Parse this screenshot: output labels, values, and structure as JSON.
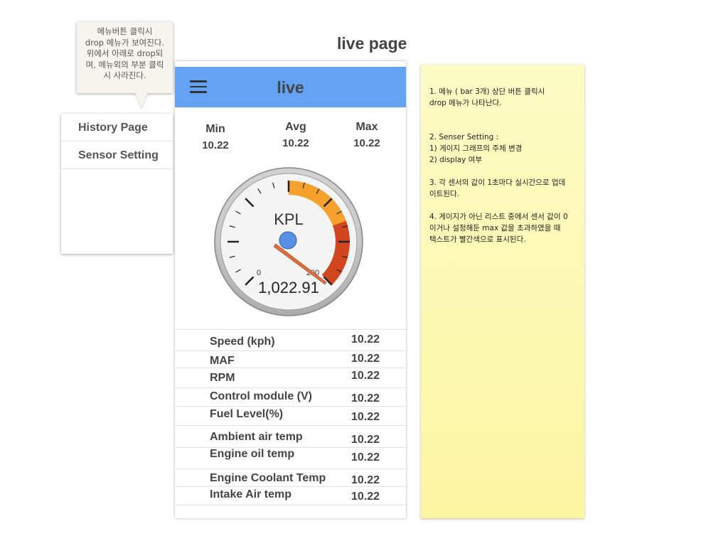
{
  "page_title": "live page",
  "tooltip": {
    "text": "메뉴버튼 클릭시\ndrop 메뉴가 보여진다.\n위에서 아래로 drop되\n며, 메뉴외의 부분 클릭\n시 사라진다."
  },
  "menu": {
    "items": [
      {
        "label": "History Page"
      },
      {
        "label": "Sensor Setting"
      }
    ]
  },
  "appbar": {
    "title": "live",
    "menu_icon": "hamburger-icon",
    "color": "#64a3f3"
  },
  "stats": {
    "min": {
      "label": "Min",
      "value": "10.22"
    },
    "avg": {
      "label": "Avg",
      "value": "10.22"
    },
    "max": {
      "label": "Max",
      "value": "10.22"
    }
  },
  "gauge": {
    "unit": "KPL",
    "min_label": "0",
    "max_label": "200",
    "reading": "1,022.91",
    "colors": {
      "warning": "#f5a12b",
      "danger": "#d1451f",
      "needle": "#e06d3e",
      "hub": "#5a8fe6"
    }
  },
  "sensors": [
    {
      "label": "Speed (kph)",
      "value": "10.22"
    },
    {
      "label": "MAF",
      "value": "10.22"
    },
    {
      "label": "RPM",
      "value": "10.22"
    },
    {
      "label": "Control module (V)",
      "value": "10.22"
    },
    {
      "label": "Fuel Level(%)",
      "value": "10.22"
    },
    {
      "label": "Ambient air temp",
      "value": "10.22"
    },
    {
      "label": "Engine oil temp",
      "value": "10.22"
    },
    {
      "label": "Engine Coolant Temp",
      "value": "10.22"
    },
    {
      "label": "Intake Air temp",
      "value": "10.22"
    }
  ],
  "note": {
    "text": "1.  메뉴 ( bar 3개) 상단 버튼 클릭시\ndrop 메뉴가 나타난다.\n\n\n2. Senser Setting :\n 1) 게이지 그래프의 주체 변경\n 2) display 여부\n\n3.  각 센서의 값이 1초마다 실시간으로 업데\n이트된다.\n\n4. 게이지가 아닌 리스트 중에서 센서 값이 0\n이거나 설정해둔 max 값을 초과하였을 때\n텍스트가 빨간색으로 표시된다."
  }
}
